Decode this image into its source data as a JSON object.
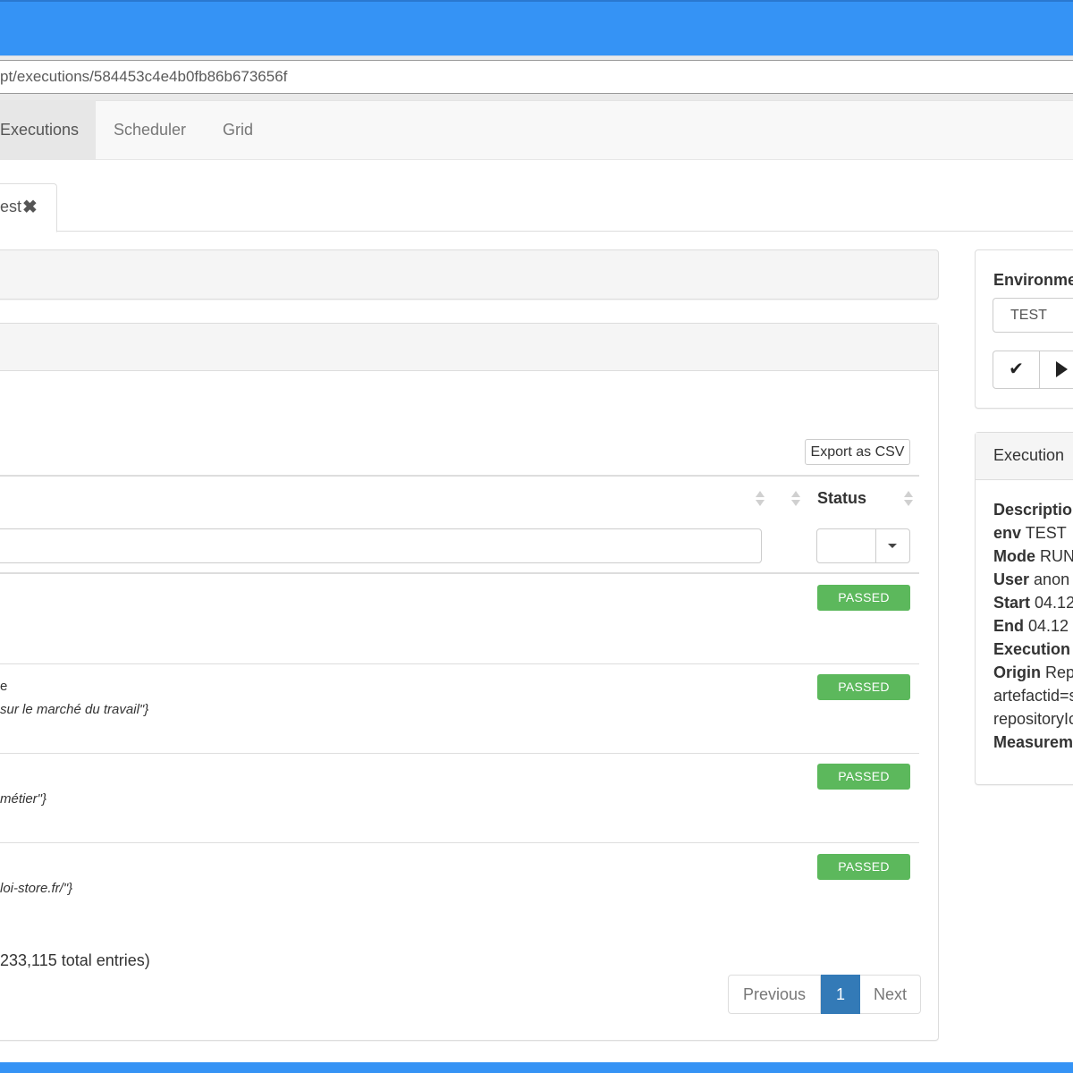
{
  "browser": {
    "url": "pt/executions/584453c4e4b0fb86b673656f"
  },
  "nav": {
    "items": [
      {
        "label": "Executions",
        "active": true
      },
      {
        "label": "Scheduler"
      },
      {
        "label": "Grid"
      }
    ]
  },
  "tab": {
    "label": "est",
    "close_icon": "✖"
  },
  "table": {
    "export_label": "Export as CSV",
    "status_header": "Status",
    "rows": [
      {
        "line1": "",
        "line2": "",
        "status": "PASSED"
      },
      {
        "line1": "e",
        "line2": "sur le marché du travail\"}",
        "status": "PASSED"
      },
      {
        "line1": "",
        "line2": "métier\"}",
        "status": "PASSED"
      },
      {
        "line1": "",
        "line2": "loi-store.fr/\"}",
        "status": "PASSED"
      }
    ],
    "entries_info": "233,115 total entries)",
    "status_color": "#5cb85c"
  },
  "pagination": {
    "previous": "Previous",
    "current": "1",
    "next": "Next",
    "active_color": "#337ab7"
  },
  "environment": {
    "title": "Environme",
    "value": "TEST",
    "check_icon": "✔",
    "play_icon": "play-icon"
  },
  "execution": {
    "title": "Execution",
    "fields": [
      {
        "key": "Descriptio",
        "value": ""
      },
      {
        "key": "env",
        "value": "TEST"
      },
      {
        "key": "Mode",
        "value": "RUN"
      },
      {
        "key": "User",
        "value": "anon"
      },
      {
        "key": "Start",
        "value": "04.12"
      },
      {
        "key": "End",
        "value": "04.12"
      },
      {
        "key": "Execution",
        "value": ""
      },
      {
        "key": "Origin",
        "value": "Rep"
      },
      {
        "key": "",
        "value": "artefactid=s"
      },
      {
        "key": "",
        "value": "repositoryIc"
      },
      {
        "key": "Measurem",
        "value": ""
      }
    ]
  },
  "colors": {
    "title_bar": "#3593f5"
  }
}
